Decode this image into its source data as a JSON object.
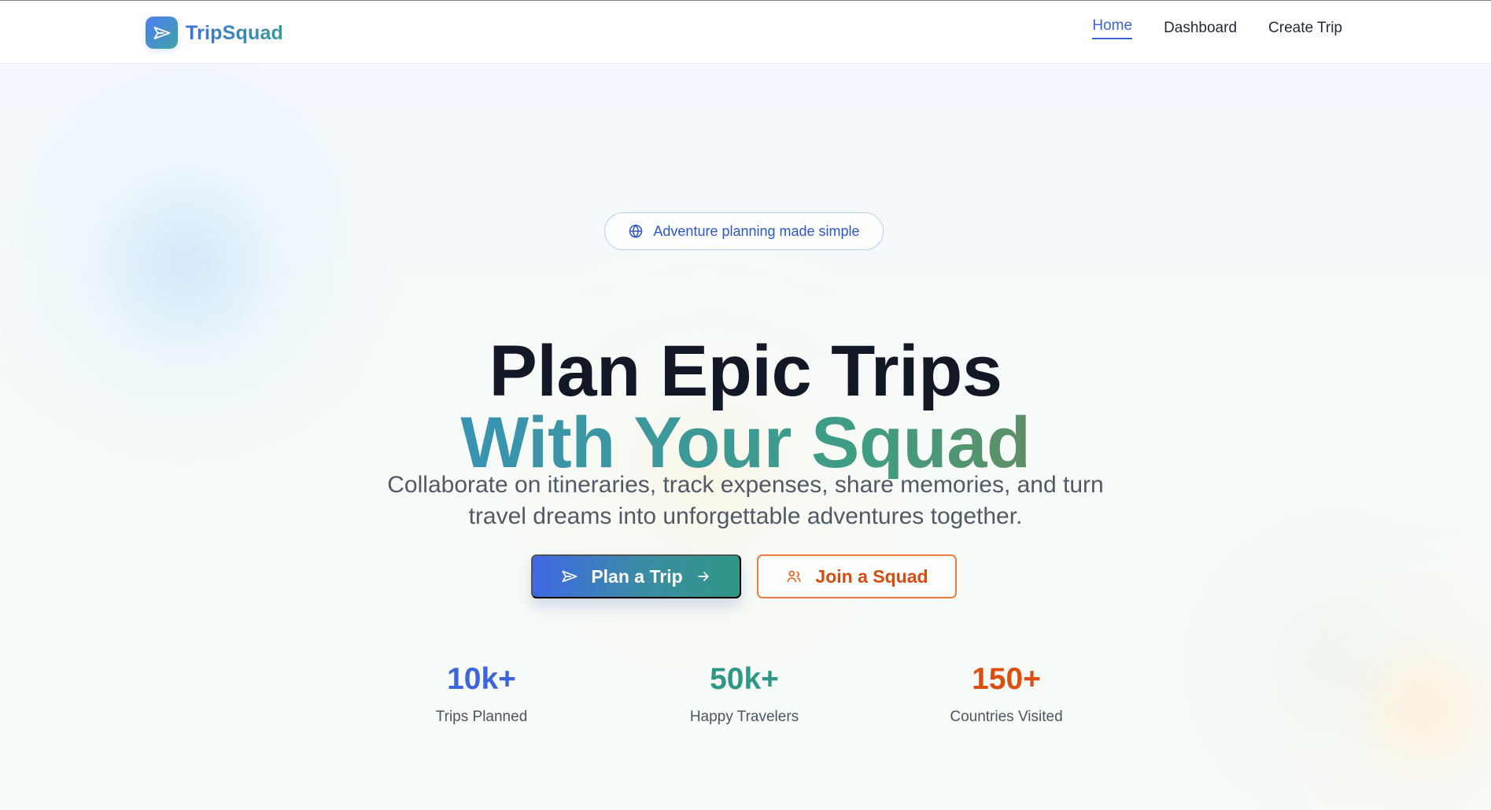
{
  "brand": {
    "name": "TripSquad",
    "icon": "plane-icon",
    "accent_start": "#4f7df0",
    "accent_end": "#3ea3a7"
  },
  "nav": {
    "items": [
      {
        "label": "Home",
        "active": true
      },
      {
        "label": "Dashboard",
        "active": false
      },
      {
        "label": "Create Trip",
        "active": false
      }
    ]
  },
  "hero": {
    "badge": {
      "text": "Adventure planning made simple",
      "icon": "globe-icon",
      "color": "#2f56c8"
    },
    "headline_line_1": "Plan Epic Trips",
    "headline_line_2": "With Your Squad",
    "subtitle_line_1": "Collaborate on itineraries, track expenses, share memories, and turn",
    "subtitle_line_2": "travel dreams into unforgettable adventures together.",
    "primary_button": {
      "label": "Plan a Trip",
      "icon_left": "plane-icon",
      "icon_right": "arrow-right-icon"
    },
    "secondary_button": {
      "label": "Join a Squad",
      "icon_left": "users-icon",
      "border_color": "#ee7a3f",
      "text_color": "#d64b0f"
    }
  },
  "stats": [
    {
      "value": "10k+",
      "label": "Trips Planned",
      "color": "#3f65de"
    },
    {
      "value": "50k+",
      "label": "Happy Travelers",
      "color": "#2f9785"
    },
    {
      "value": "150+",
      "label": "Countries Visited",
      "color": "#dd4f0f"
    }
  ]
}
